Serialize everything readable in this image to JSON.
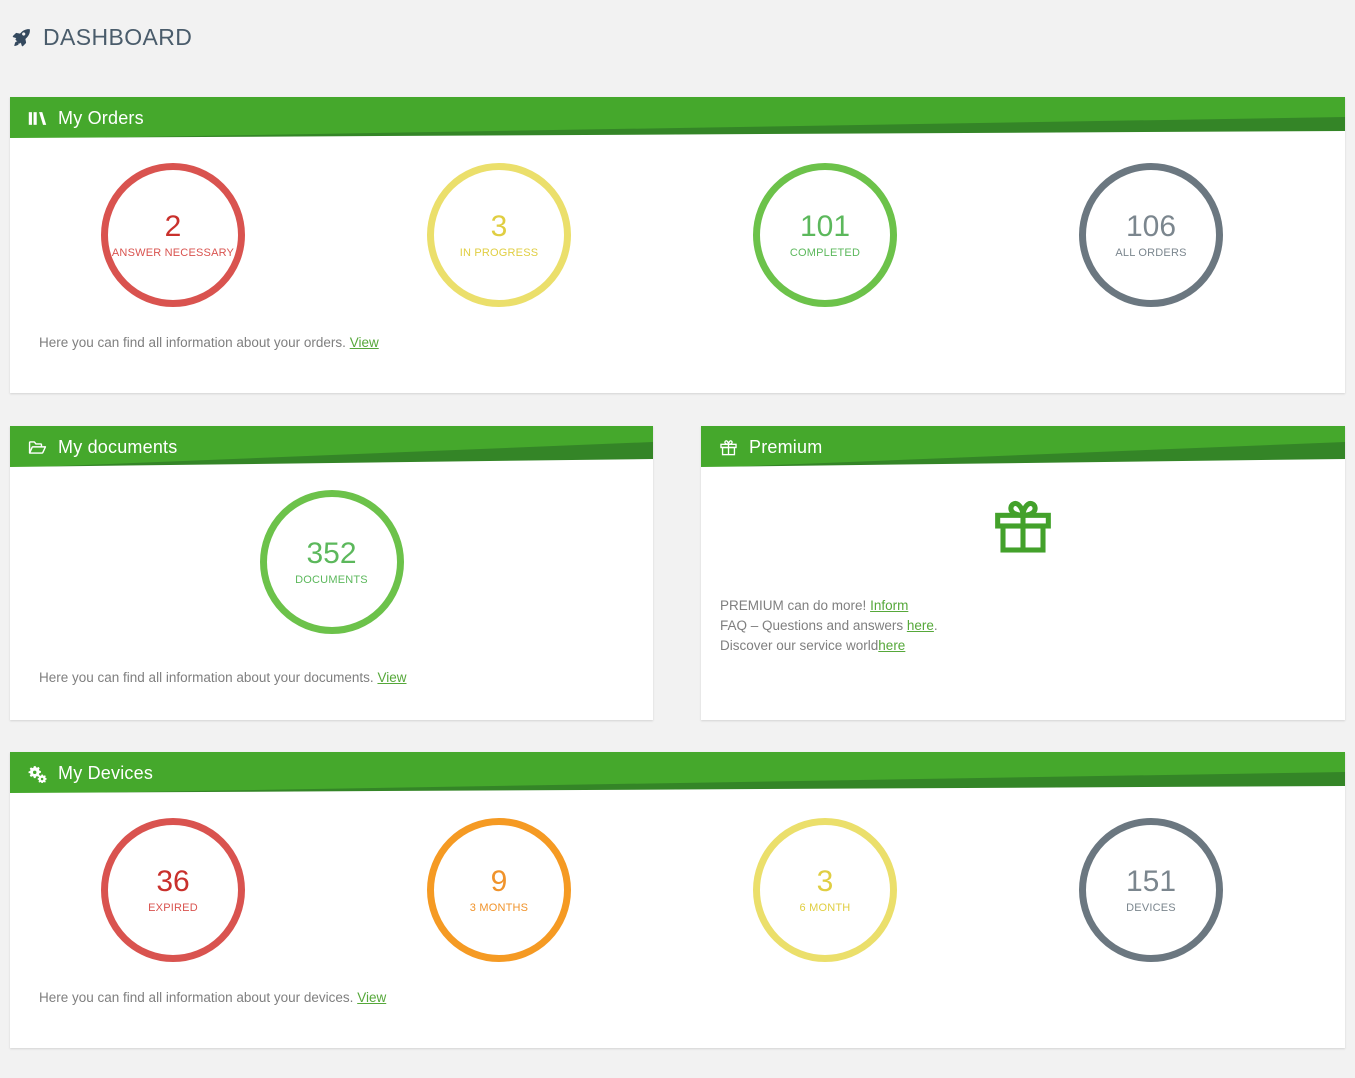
{
  "header": {
    "title": "DASHBOARD",
    "icon": "rocket-icon"
  },
  "colors": {
    "head_green_light": "#45a82c",
    "head_green_dark": "#348527",
    "link_green": "#56a83a",
    "page_background": "#f2f2f2",
    "title_text": "#4a5c6b",
    "note_text": "#7f7f7f",
    "red": "#d9534f",
    "red_text": "#c9302c",
    "yellow": "#ebdf6b",
    "yellow_text": "#e0ce42",
    "green": "#6cc24a",
    "gray": "#6b7780",
    "orange": "#f59a23"
  },
  "cards": {
    "orders": {
      "title": "My Orders",
      "icon": "bar-chart-icon",
      "stats": [
        {
          "value": "2",
          "label": "ANSWER NECESSARY",
          "ring": "#d9534f",
          "num_color": "#c9302c",
          "label_color": "#d9534f"
        },
        {
          "value": "3",
          "label": "IN PROGRESS",
          "ring": "#ebdf6b",
          "num_color": "#e0ce42",
          "label_color": "#e0ce42"
        },
        {
          "value": "101",
          "label": "COMPLETED",
          "ring": "#6cc24a",
          "num_color": "#5cb85c",
          "label_color": "#5cb85c"
        },
        {
          "value": "106",
          "label": "ALL ORDERS",
          "ring": "#6b7780",
          "num_color": "#7b868e",
          "label_color": "#7b868e"
        }
      ],
      "note_text": "Here you can find all information about your orders.",
      "note_link": "View"
    },
    "documents": {
      "title": "My documents",
      "icon": "folder-open-icon",
      "stats": [
        {
          "value": "352",
          "label": "DOCUMENTS",
          "ring": "#6cc24a",
          "num_color": "#5cb85c",
          "label_color": "#5cb85c"
        }
      ],
      "note_text": "Here you can find all information about your documents.",
      "note_link": "View"
    },
    "premium": {
      "title": "Premium",
      "icon": "gift-icon",
      "graphic_icon": "gift-box-icon",
      "lines": [
        {
          "text": "PREMIUM can do more!",
          "link": "Inform",
          "tail": ""
        },
        {
          "text": "FAQ – Questions and answers ",
          "link": "here",
          "tail": "."
        },
        {
          "text": "Discover our service world",
          "link": "here",
          "tail": ""
        }
      ]
    },
    "devices": {
      "title": "My Devices",
      "icon": "cogs-icon",
      "stats": [
        {
          "value": "36",
          "label": "EXPIRED",
          "ring": "#d9534f",
          "num_color": "#c9302c",
          "label_color": "#d9534f"
        },
        {
          "value": "9",
          "label": "3 MONTHS",
          "ring": "#f59a23",
          "num_color": "#f0932b",
          "label_color": "#f0932b"
        },
        {
          "value": "3",
          "label": "6 MONTH",
          "ring": "#ebdf6b",
          "num_color": "#e0ce42",
          "label_color": "#e0ce42"
        },
        {
          "value": "151",
          "label": "DEVICES",
          "ring": "#6b7780",
          "num_color": "#7b868e",
          "label_color": "#7b868e"
        }
      ],
      "note_text": "Here you can find all information about your devices.",
      "note_link": "View"
    }
  }
}
